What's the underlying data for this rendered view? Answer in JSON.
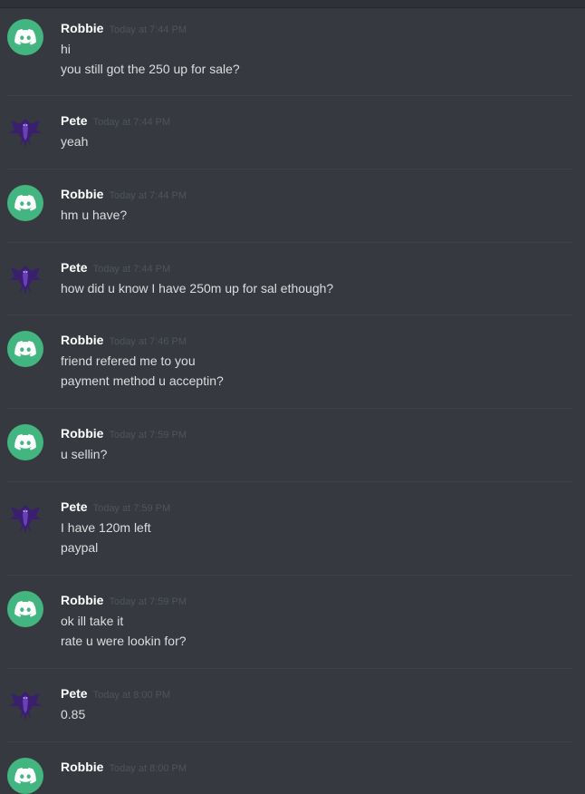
{
  "colors": {
    "background": "#36393f",
    "username": "#ffffff",
    "timestamp": "#4f545c",
    "text": "#dcddde",
    "discord_avatar": "#43b581",
    "dragon_purple": "#4b2a8a"
  },
  "messages": [
    {
      "user": "Robbie",
      "avatar": "discord-avatar",
      "time": "Today at 7:44 PM",
      "lines": [
        "hi",
        "you still got the 250 up for sale?"
      ]
    },
    {
      "user": "Pete",
      "avatar": "dragon-avatar",
      "time": "Today at 7:44 PM",
      "lines": [
        "yeah"
      ]
    },
    {
      "user": "Robbie",
      "avatar": "discord-avatar",
      "time": "Today at 7:44 PM",
      "lines": [
        "hm u have?"
      ]
    },
    {
      "user": "Pete",
      "avatar": "dragon-avatar",
      "time": "Today at 7:44 PM",
      "lines": [
        "how did u know I have 250m up for sal ethough?"
      ]
    },
    {
      "user": "Robbie",
      "avatar": "discord-avatar",
      "time": "Today at 7:46 PM",
      "lines": [
        "friend refered me to you",
        "payment method u acceptin?"
      ]
    },
    {
      "user": "Robbie",
      "avatar": "discord-avatar",
      "time": "Today at 7:59 PM",
      "lines": [
        "u sellin?"
      ]
    },
    {
      "user": "Pete",
      "avatar": "dragon-avatar",
      "time": "Today at 7:59 PM",
      "lines": [
        "I have 120m left",
        "paypal"
      ]
    },
    {
      "user": "Robbie",
      "avatar": "discord-avatar",
      "time": "Today at 7:59 PM",
      "lines": [
        "ok ill take it",
        "rate u were lookin for?"
      ]
    },
    {
      "user": "Pete",
      "avatar": "dragon-avatar",
      "time": "Today at 8:00 PM",
      "lines": [
        "0.85"
      ]
    },
    {
      "user": "Robbie",
      "avatar": "discord-avatar",
      "time": "Today at 8:00 PM",
      "lines": []
    }
  ]
}
